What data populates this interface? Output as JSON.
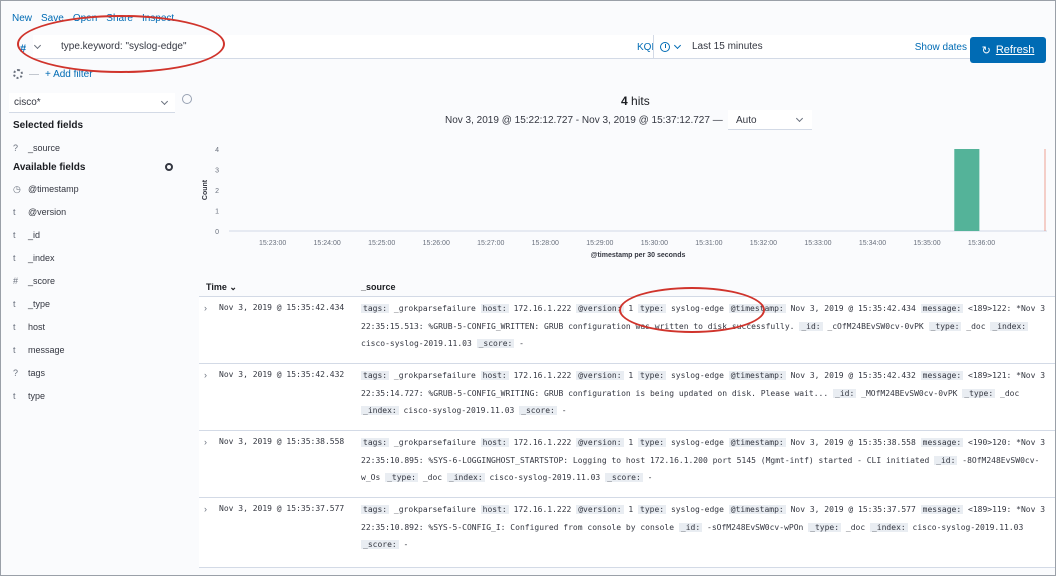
{
  "menu": [
    "New",
    "Save",
    "Open",
    "Share",
    "Inspect"
  ],
  "query": {
    "value": "type.keyword: \"syslog-edge\"",
    "language": "KQL",
    "hash_icon": "#"
  },
  "timepicker": {
    "range": "Last 15 minutes",
    "show_dates": "Show dates"
  },
  "refresh_label": "Refresh",
  "add_filter": "+ Add filter",
  "sidebar": {
    "index_pattern": "cisco*",
    "selected_title": "Selected fields",
    "selected": [
      {
        "type": "?",
        "name": "_source"
      }
    ],
    "available_title": "Available fields",
    "available": [
      {
        "type": "◷",
        "name": "@timestamp"
      },
      {
        "type": "t",
        "name": "@version"
      },
      {
        "type": "t",
        "name": "_id"
      },
      {
        "type": "t",
        "name": "_index"
      },
      {
        "type": "#",
        "name": "_score"
      },
      {
        "type": "t",
        "name": "_type"
      },
      {
        "type": "t",
        "name": "host"
      },
      {
        "type": "t",
        "name": "message"
      },
      {
        "type": "?",
        "name": "tags"
      },
      {
        "type": "t",
        "name": "type"
      }
    ]
  },
  "hits": {
    "count": "4",
    "label": "hits"
  },
  "date_range": "Nov 3, 2019 @ 15:22:12.727 - Nov 3, 2019 @ 15:37:12.727 —",
  "interval": "Auto",
  "chart_data": {
    "type": "bar",
    "ylabel": "Count",
    "xlabel": "@timestamp per 30 seconds",
    "y_ticks": [
      "0",
      "1",
      "2",
      "3",
      "4"
    ],
    "ylim": [
      0,
      4
    ],
    "x_ticks": [
      "15:23:00",
      "15:24:00",
      "15:25:00",
      "15:26:00",
      "15:27:00",
      "15:28:00",
      "15:29:00",
      "15:30:00",
      "15:31:00",
      "15:32:00",
      "15:33:00",
      "15:34:00",
      "15:35:00",
      "15:36:00"
    ],
    "bars": [
      {
        "x": "15:35:30",
        "value": 4
      }
    ],
    "colors": {
      "bar": "#54b399",
      "now_line": "#e7664c"
    }
  },
  "table": {
    "col_time": "Time ⌄",
    "col_source": "_source",
    "rows": [
      {
        "time": "Nov 3, 2019 @ 15:35:42.434",
        "fields": [
          [
            "tags:",
            "_grokparsefailure"
          ],
          [
            "host:",
            "172.16.1.222"
          ],
          [
            "@version:",
            "1"
          ],
          [
            "type:",
            "syslog-edge"
          ],
          [
            "@timestamp:",
            "Nov 3, 2019 @ 15:35:42.434"
          ],
          [
            "message:",
            "<189>122: *Nov 3 22:35:15.513: %GRUB-5-CONFIG_WRITTEN: GRUB configuration was written to disk successfully."
          ],
          [
            "_id:",
            "_cOfM24BEvSW0cv-0vPK"
          ],
          [
            "_type:",
            "_doc"
          ],
          [
            "_index:",
            "cisco-syslog-2019.11.03"
          ],
          [
            "_score:",
            "-"
          ]
        ]
      },
      {
        "time": "Nov 3, 2019 @ 15:35:42.432",
        "fields": [
          [
            "tags:",
            "_grokparsefailure"
          ],
          [
            "host:",
            "172.16.1.222"
          ],
          [
            "@version:",
            "1"
          ],
          [
            "type:",
            "syslog-edge"
          ],
          [
            "@timestamp:",
            "Nov 3, 2019 @ 15:35:42.432"
          ],
          [
            "message:",
            "<189>121: *Nov 3 22:35:14.727: %GRUB-5-CONFIG_WRITING: GRUB configuration is being updated on disk. Please wait..."
          ],
          [
            "_id:",
            "_MOfM24BEvSW0cv-0vPK"
          ],
          [
            "_type:",
            "_doc"
          ],
          [
            "_index:",
            "cisco-syslog-2019.11.03"
          ],
          [
            "_score:",
            "-"
          ]
        ]
      },
      {
        "time": "Nov 3, 2019 @ 15:35:38.558",
        "fields": [
          [
            "tags:",
            "_grokparsefailure"
          ],
          [
            "host:",
            "172.16.1.222"
          ],
          [
            "@version:",
            "1"
          ],
          [
            "type:",
            "syslog-edge"
          ],
          [
            "@timestamp:",
            "Nov 3, 2019 @ 15:35:38.558"
          ],
          [
            "message:",
            "<190>120: *Nov 3 22:35:10.895: %SYS-6-LOGGINGHOST_STARTSTOP: Logging to host 172.16.1.200 port 5145 (Mgmt-intf) started - CLI initiated"
          ],
          [
            "_id:",
            "-8OfM248EvSW0cv-w_Os"
          ],
          [
            "_type:",
            "_doc"
          ],
          [
            "_index:",
            "cisco-syslog-2019.11.03"
          ],
          [
            "_score:",
            "-"
          ]
        ]
      },
      {
        "time": "Nov 3, 2019 @ 15:35:37.577",
        "fields": [
          [
            "tags:",
            "_grokparsefailure"
          ],
          [
            "host:",
            "172.16.1.222"
          ],
          [
            "@version:",
            "1"
          ],
          [
            "type:",
            "syslog-edge"
          ],
          [
            "@timestamp:",
            "Nov 3, 2019 @ 15:35:37.577"
          ],
          [
            "message:",
            "<189>119: *Nov 3 22:35:10.892: %SYS-5-CONFIG_I: Configured from console by console"
          ],
          [
            "_id:",
            "-sOfM248EvSW0cv-wPOn"
          ],
          [
            "_type:",
            "_doc"
          ],
          [
            "_index:",
            "cisco-syslog-2019.11.03"
          ],
          [
            "_score:",
            "-"
          ]
        ]
      }
    ]
  }
}
